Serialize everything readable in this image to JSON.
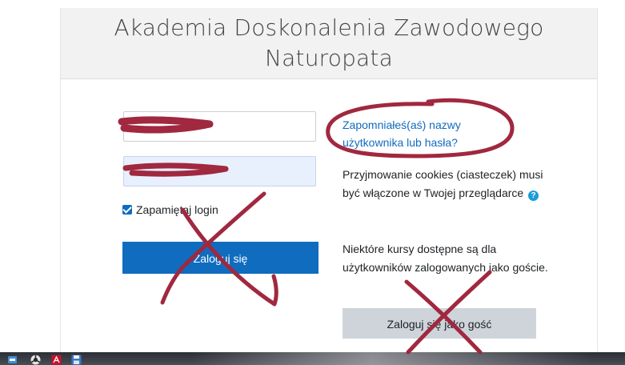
{
  "header": {
    "site_title": "Akademia Doskonalenia Zawodowego Naturopata"
  },
  "login_form": {
    "username_value": "",
    "password_value": "",
    "remember_label": "Zapamiętaj login",
    "remember_checked": true,
    "submit_label": "Zaloguj się"
  },
  "side_info": {
    "forgot_link": "Zapomniałeś(aś) nazwy użytkownika lub hasła?",
    "cookies_text": "Przyjmowanie cookies (ciasteczek) musi być włączone w Twojej przeglądarce",
    "help_icon": "question-circle-icon",
    "guest_text": "Niektóre kursy dostępne są dla użytkowników zalogowanych jako goście.",
    "guest_button_label": "Zaloguj się jako gość"
  },
  "taskbar": {
    "icons": [
      "app-icon",
      "chrome-icon",
      "pdf-icon",
      "save-icon"
    ]
  },
  "colors": {
    "primary": "#0f6cbf",
    "annotation_ink": "#a0283f",
    "header_bg": "#f2f2f2",
    "secondary_button": "#ced4da"
  }
}
